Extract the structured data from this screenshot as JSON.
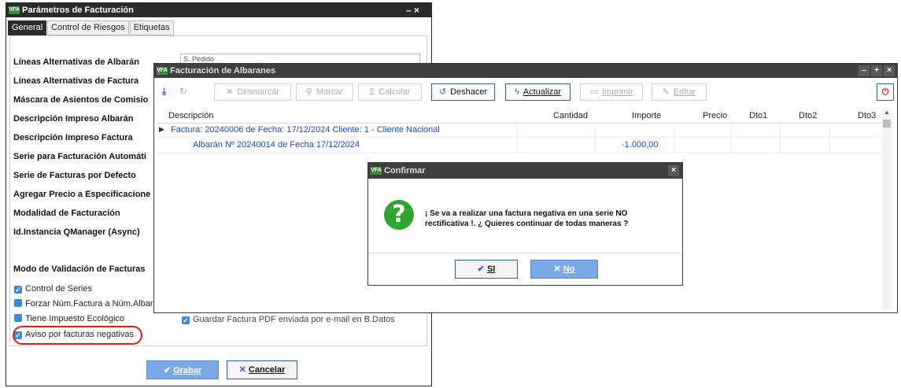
{
  "params_window": {
    "title": "Parámetros de Facturación",
    "controls": "– ×",
    "tabs": [
      "General",
      "Control de Riesgos",
      "Etiquetas"
    ],
    "labels": [
      "Líneas Alternativas de Albarán",
      "Líneas Alternativas de Factura",
      "Máscara de Asientos de Comisio",
      "Descripción Impreso Albarán",
      "Descripción Impreso Factura",
      "Serie para Facturación Automáti",
      "Serie de Facturas por Defecto",
      "Agregar Precio a Especificacione",
      "Modalidad de Facturación",
      "Id.Instancia QManager (Async)"
    ],
    "input_partial": "S. Pedido",
    "section_title": "Modo de Validación de Facturas",
    "checkboxes": [
      {
        "label": "Control de Series",
        "checked": true
      },
      {
        "label": "Forzar Núm.Factura a Núm.Albar",
        "checked": false
      },
      {
        "label": "Tiene Impuesto Ecológico",
        "checked": false
      },
      {
        "label": "Aviso por facturas negativas",
        "checked": true
      }
    ],
    "hidden_checkbox_label": "Guardar Factura PDF enviada por e-mail en B.Datos",
    "save_icon": "✔",
    "save_label": "Grabar",
    "cancel_icon": "✕",
    "cancel_label": "Cancelar"
  },
  "albaranes_window": {
    "title": "Facturación de Albaranes",
    "toolbar": {
      "desmarcar": "Desmarcar",
      "marcar": "Marcar",
      "calcular": "Calcular",
      "deshacer": "Deshacer",
      "actualizar": "Actualizar",
      "imprimir": "Imprimir",
      "editar": "Editar"
    },
    "columns": [
      "Descripción",
      "Cantidad",
      "Importe",
      "Precio",
      "Dto1",
      "Dto2",
      "Dto3"
    ],
    "rows": [
      {
        "descripcion": "Factura: 20240006 de Fecha: 17/12/2024 Cliente: 1 - Cliente Nacional",
        "importe": ""
      },
      {
        "descripcion": "Albarán Nº 20240014 de Fecha 17/12/2024",
        "importe": "-1.000,00"
      }
    ]
  },
  "confirm_dialog": {
    "title": "Confirmar",
    "icon": "?",
    "message": "¡ Se va a realizar una factura negativa en una serie NO rectificativa !. ¿ Quieres continuar de todas maneras ?",
    "yes_icon": "✔",
    "yes_label": "SI",
    "no_icon": "✕",
    "no_label": "No"
  },
  "app_logo": "VFA"
}
